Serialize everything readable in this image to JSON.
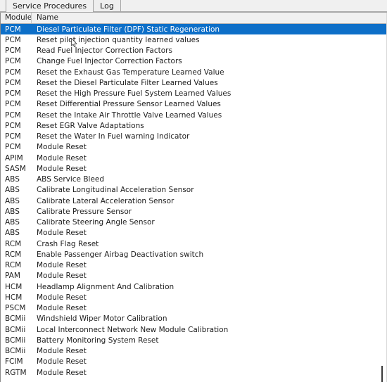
{
  "window": {
    "title": "Service Procedures"
  },
  "tabs": [
    {
      "label": "Service Procedures",
      "active": true
    },
    {
      "label": "Log",
      "active": false
    }
  ],
  "table": {
    "columns": [
      "Module",
      "Name"
    ],
    "selected_index": 0,
    "selection_color": "#0d6fc8",
    "rows": [
      {
        "module": "PCM",
        "name": "Diesel Particulate Filter (DPF) Static Regeneration"
      },
      {
        "module": "PCM",
        "name": "Reset pilot injection quantity learned values"
      },
      {
        "module": "PCM",
        "name": "Read Fuel Injector Correction Factors"
      },
      {
        "module": "PCM",
        "name": "Change Fuel Injector Correction Factors"
      },
      {
        "module": "PCM",
        "name": "Reset the Exhaust Gas Temperature Learned Value"
      },
      {
        "module": "PCM",
        "name": "Reset the Diesel Particulate Filter Learned Values"
      },
      {
        "module": "PCM",
        "name": "Reset the High Pressure Fuel System Learned Values"
      },
      {
        "module": "PCM",
        "name": "Reset Differential Pressure Sensor Learned Values"
      },
      {
        "module": "PCM",
        "name": "Reset the Intake Air Throttle Valve Learned Values"
      },
      {
        "module": "PCM",
        "name": "Reset EGR Valve Adaptations"
      },
      {
        "module": "PCM",
        "name": "Reset the Water In Fuel warning Indicator"
      },
      {
        "module": "PCM",
        "name": "Module Reset"
      },
      {
        "module": "APIM",
        "name": "Module Reset"
      },
      {
        "module": "SASM",
        "name": "Module Reset"
      },
      {
        "module": "ABS",
        "name": "ABS Service Bleed"
      },
      {
        "module": "ABS",
        "name": "Calibrate Longitudinal Acceleration Sensor"
      },
      {
        "module": "ABS",
        "name": "Calibrate Lateral Acceleration Sensor"
      },
      {
        "module": "ABS",
        "name": "Calibrate Pressure Sensor"
      },
      {
        "module": "ABS",
        "name": "Calibrate Steering Angle Sensor"
      },
      {
        "module": "ABS",
        "name": "Module Reset"
      },
      {
        "module": "RCM",
        "name": "Crash Flag Reset"
      },
      {
        "module": "RCM",
        "name": "Enable Passenger Airbag Deactivation switch"
      },
      {
        "module": "RCM",
        "name": "Module Reset"
      },
      {
        "module": "PAM",
        "name": "Module Reset"
      },
      {
        "module": "HCM",
        "name": "Headlamp Alignment And Calibration"
      },
      {
        "module": "HCM",
        "name": "Module Reset"
      },
      {
        "module": "PSCM",
        "name": "Module Reset"
      },
      {
        "module": "BCMii",
        "name": "Windshield Wiper Motor Calibration"
      },
      {
        "module": "BCMii",
        "name": "Local Interconnect Network New Module Calibration"
      },
      {
        "module": "BCMii",
        "name": "Battery Monitoring System Reset"
      },
      {
        "module": "BCMii",
        "name": "Module Reset"
      },
      {
        "module": "FCIM",
        "name": "Module Reset"
      },
      {
        "module": "RGTM",
        "name": "Module Reset"
      }
    ]
  }
}
